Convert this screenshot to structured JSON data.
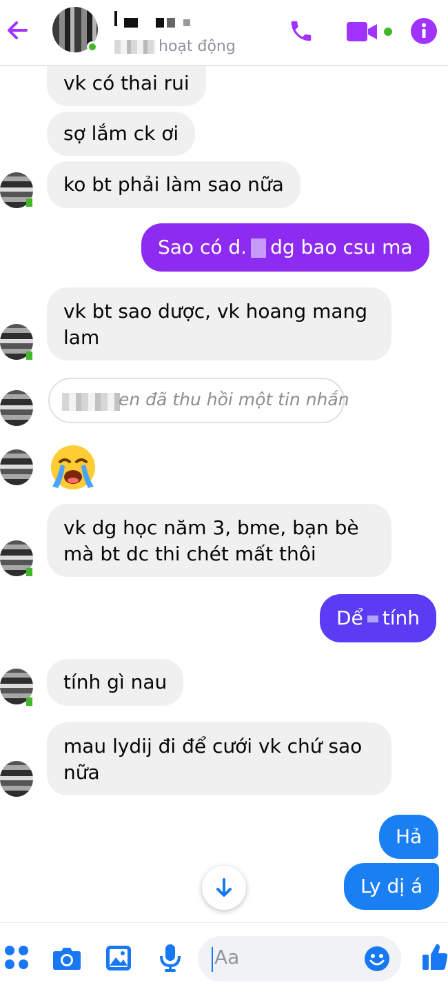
{
  "header": {
    "status_text": "hoạt động"
  },
  "colors": {
    "accent_purple": "#a033ff",
    "bubble_purple": "#8d2cf0",
    "bubble_indigo": "#5b3cf4",
    "bubble_blue": "#1a7ff2",
    "incoming_bubble": "#f0f0f0"
  },
  "icons": {
    "back": "back-arrow-icon",
    "call": "phone-icon",
    "video": "video-camera-icon",
    "info": "info-icon",
    "emoji_reaction": "crying-face-emoji",
    "scroll": "arrow-down-icon",
    "menu": "four-dots-icon",
    "camera": "camera-icon",
    "gallery": "image-icon",
    "mic": "microphone-icon",
    "emoji": "smiley-icon",
    "like": "thumbs-up-icon"
  },
  "messages": [
    {
      "direction": "in",
      "text": "vk có thai rui"
    },
    {
      "direction": "in",
      "text": "sợ lắm ck ơi"
    },
    {
      "direction": "in",
      "text": "ko bt phải làm sao nữa"
    },
    {
      "direction": "out",
      "text_before": "Sao có d.",
      "text_after": "dg bao csu ma"
    },
    {
      "direction": "in",
      "text": "vk bt sao dược, vk hoang mang lam"
    },
    {
      "direction": "system",
      "text": "en đã thu hồi một tin nhắn"
    },
    {
      "direction": "in",
      "emoji": "😭"
    },
    {
      "direction": "in",
      "text": "vk dg học năm 3, bme, bạn bè mà bt dc thi chét mất thôi"
    },
    {
      "direction": "out",
      "text_before": "Dể",
      "text_after": "tính"
    },
    {
      "direction": "in",
      "text": "tính gì nau"
    },
    {
      "direction": "in",
      "text": "mau lydij đi để cưới vk chứ sao nữa"
    },
    {
      "direction": "out",
      "text": "Hả"
    },
    {
      "direction": "out",
      "text": "Ly dị á"
    }
  ],
  "composer": {
    "placeholder": "Aa"
  }
}
